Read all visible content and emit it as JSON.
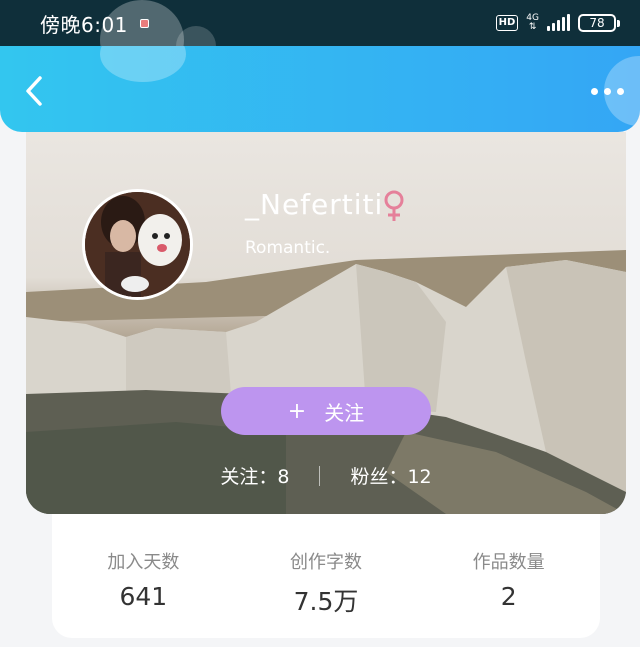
{
  "status_bar": {
    "time": "傍晚6:01",
    "hd": "HD",
    "network": "4G",
    "battery": "78"
  },
  "profile": {
    "username": "_Nefertiti",
    "gender_symbol": "♀",
    "bio": "Romantic.",
    "follow_label": "关注",
    "follow_plus": "+",
    "following_label": "关注：8",
    "followers_label": "粉丝：12"
  },
  "info": [
    {
      "label": "加入天数",
      "value": "641"
    },
    {
      "label": "创作字数",
      "value": "7.5万"
    },
    {
      "label": "作品数量",
      "value": "2"
    }
  ],
  "colors": {
    "header_start": "#33c6ef",
    "header_end": "#34a6f5",
    "follow_button": "#bd95ef",
    "gender": "#e5809a"
  },
  "icons": {
    "back": "chevron-left-icon",
    "more": "more-dots-icon",
    "gender": "female-icon"
  }
}
